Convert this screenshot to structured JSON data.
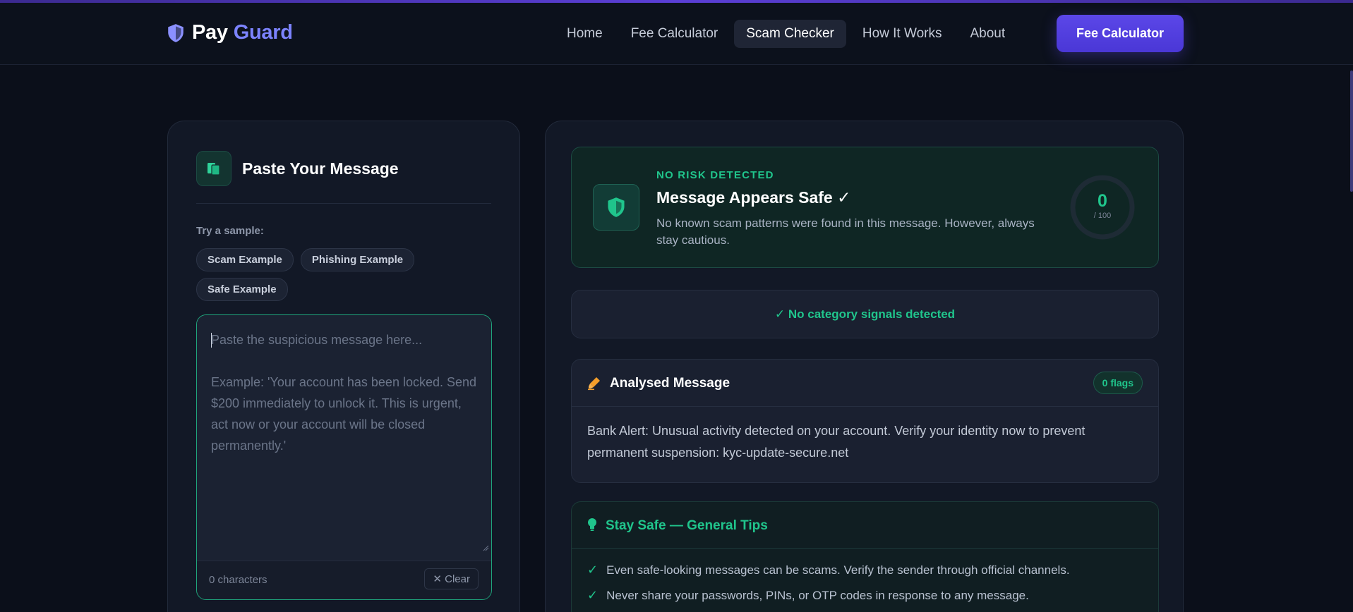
{
  "brand": {
    "part1": "Pay",
    "part2": "Guard"
  },
  "nav": {
    "links": [
      {
        "label": "Home",
        "active": false
      },
      {
        "label": "Fee Calculator",
        "active": false
      },
      {
        "label": "Scam Checker",
        "active": true
      },
      {
        "label": "How It Works",
        "active": false
      },
      {
        "label": "About",
        "active": false
      }
    ],
    "cta": "Fee Calculator"
  },
  "input_panel": {
    "title": "Paste Your Message",
    "sample_label": "Try a sample:",
    "samples": [
      "Scam Example",
      "Phishing Example",
      "Safe Example"
    ],
    "textarea": {
      "value": "",
      "placeholder": "Paste the suspicious message here...\n\nExample: 'Your account has been locked. Send $200 immediately to unlock it. This is urgent, act now or your account will be closed permanently.'"
    },
    "char_count": "0 characters",
    "clear_label": "✕ Clear"
  },
  "result": {
    "risk_label": "NO RISK DETECTED",
    "title": "Message Appears Safe ✓",
    "description": "No known scam patterns were found in this message. However, always stay cautious.",
    "score": "0",
    "score_max": "/ 100",
    "score_fraction": 0
  },
  "signals": {
    "text": "✓ No category signals detected"
  },
  "analysed": {
    "title": "Analysed Message",
    "flags": "0 flags",
    "text": "Bank Alert: Unusual activity detected on your account. Verify your identity now to prevent permanent suspension: kyc-update-secure.net"
  },
  "tips": {
    "title": "Stay Safe — General Tips",
    "items": [
      "Even safe-looking messages can be scams. Verify the sender through official channels.",
      "Never share your passwords, PINs, or OTP codes in response to any message."
    ]
  },
  "colors": {
    "accent": "#5b47e8",
    "brand_guard": "#7c83ff",
    "safe": "#20c58c",
    "background": "#0b0f1a"
  },
  "icons": {
    "brand": "shield-icon",
    "paste": "clipboard-icon",
    "result": "shield-check-icon",
    "analysed": "highlighter-icon",
    "tips": "lightbulb-icon"
  }
}
